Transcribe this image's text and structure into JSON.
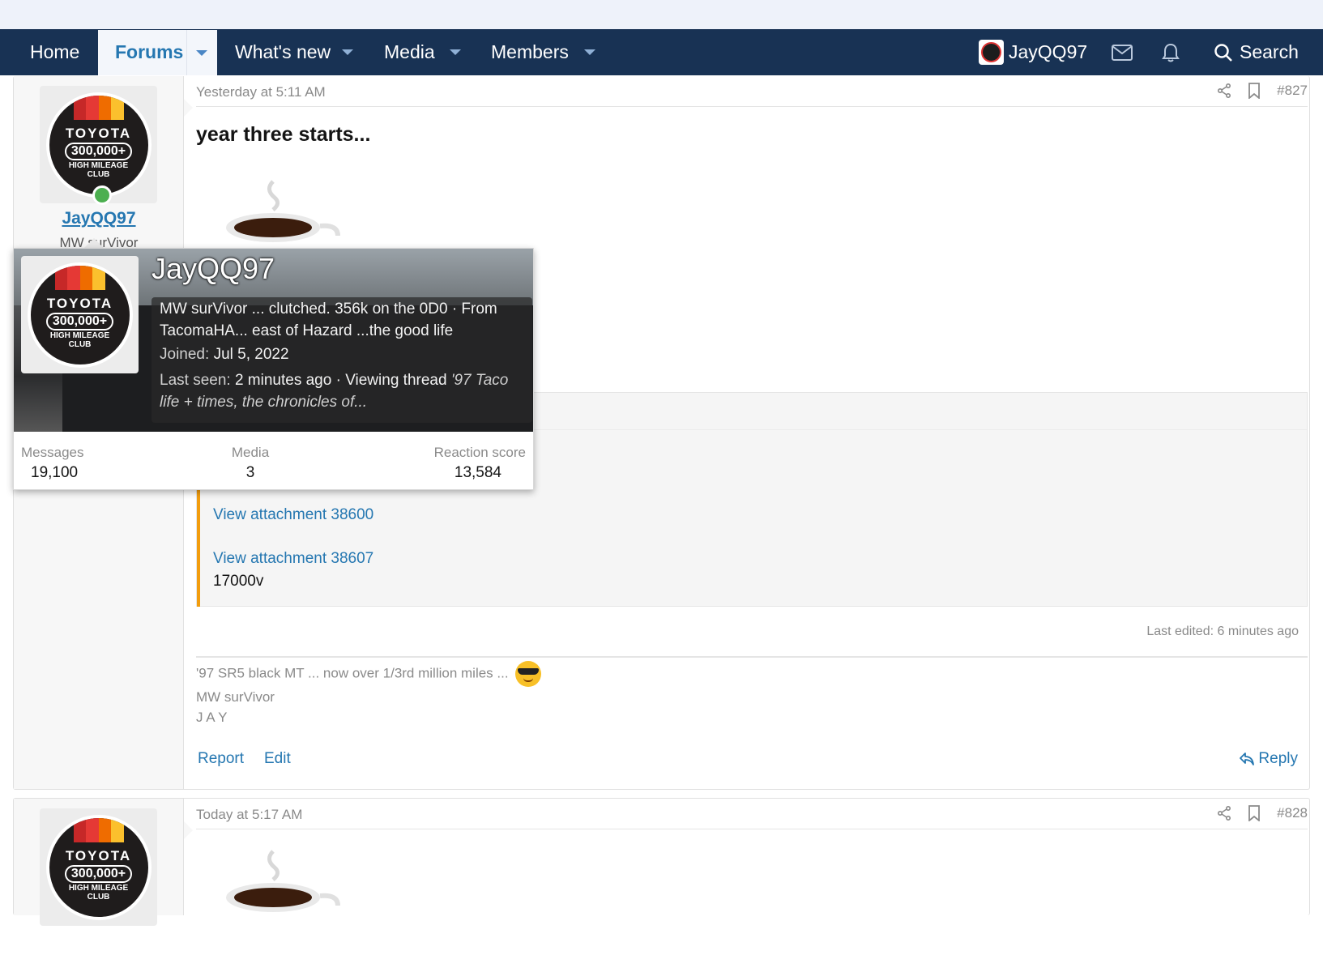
{
  "nav": {
    "home": "Home",
    "forums": "Forums",
    "whats_new": "What's new",
    "media": "Media",
    "members": "Members",
    "username": "JayQQ97",
    "search": "Search"
  },
  "post1": {
    "date": "Yesterday at 5:11 AM",
    "number": "#827",
    "title": "year three starts...",
    "username": "JayQQ97",
    "user_title_partial": "MW surVivor",
    "attachment_1": "View attachment 38600",
    "attachment_2": "View attachment 38607",
    "quote_text": "17000v",
    "last_edited": "Last edited: 6 minutes ago",
    "signature_1": "'97 SR5 black MT ... now over 1/3rd million miles ...",
    "signature_2": "MW surVivor",
    "signature_3": "J A Y",
    "report": "Report",
    "edit": "Edit",
    "reply": "Reply"
  },
  "post2": {
    "date": "Today at 5:17 AM",
    "number": "#828"
  },
  "badge": {
    "brand": "TOYOTA",
    "miles": "300,000+",
    "line1": "HIGH MILEAGE",
    "line2": "CLUB"
  },
  "tooltip": {
    "name": "JayQQ97",
    "about": "MW surVivor ... clutched. 356k on the 0D0 · From TacomaHA... east of Hazard ...the good life",
    "joined_label": "Joined:",
    "joined_value": "Jul 5, 2022",
    "last_seen_label": "Last seen:",
    "last_seen_value": "2 minutes ago · Viewing thread",
    "last_seen_thread": "'97 Taco life + times, the chronicles of...",
    "stats": [
      {
        "label": "Messages",
        "value": "19,100"
      },
      {
        "label": "Media",
        "value": "3"
      },
      {
        "label": "Reaction score",
        "value": "13,584"
      }
    ]
  },
  "colors": {
    "navbar": "#183254",
    "link": "#2577b1",
    "quote_bar": "#f29d0e",
    "online": "#4caf50"
  }
}
